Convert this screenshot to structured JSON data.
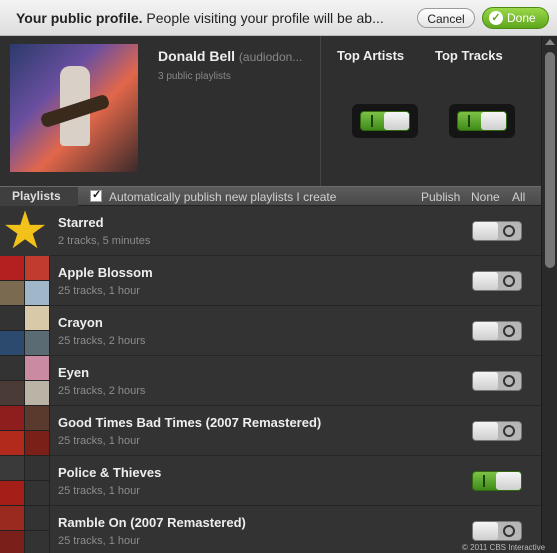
{
  "topbar": {
    "title_bold": "Your public profile.",
    "title_rest": " People visiting your profile will be ab...",
    "cancel_label": "Cancel",
    "done_label": "Done"
  },
  "profile": {
    "name": "Donald Bell",
    "username": "(audiodon...",
    "subtitle": "3 public playlists"
  },
  "top_artists": {
    "label": "Top Artists",
    "on": true
  },
  "top_tracks": {
    "label": "Top Tracks",
    "on": true
  },
  "listbar": {
    "tab": "Playlists",
    "autopublish_label": "Automatically publish new playlists I create",
    "autopublish_checked": true,
    "publish_label": "Publish",
    "none_label": "None",
    "all_label": "All"
  },
  "playlists": [
    {
      "title": "Starred",
      "meta": "2 tracks, 5 minutes",
      "published": false,
      "icon": "star-icon"
    },
    {
      "title": "Apple Blossom",
      "meta": "25 tracks, 1 hour",
      "published": false
    },
    {
      "title": "Crayon",
      "meta": "25 tracks, 2 hours",
      "published": false
    },
    {
      "title": "Eyen",
      "meta": "25 tracks, 2 hours",
      "published": false
    },
    {
      "title": "Good Times Bad Times (2007 Remastered)",
      "meta": "25 tracks, 1 hour",
      "published": false
    },
    {
      "title": "Police & Thieves",
      "meta": "25 tracks, 1 hour",
      "published": true
    },
    {
      "title": "Ramble On (2007 Remastered)",
      "meta": "25 tracks, 1 hour",
      "published": false
    }
  ],
  "copyright": "© 2011 CBS Interactive",
  "colors": {
    "accent_green": "#5ea61c",
    "star": "#f2c21a"
  }
}
